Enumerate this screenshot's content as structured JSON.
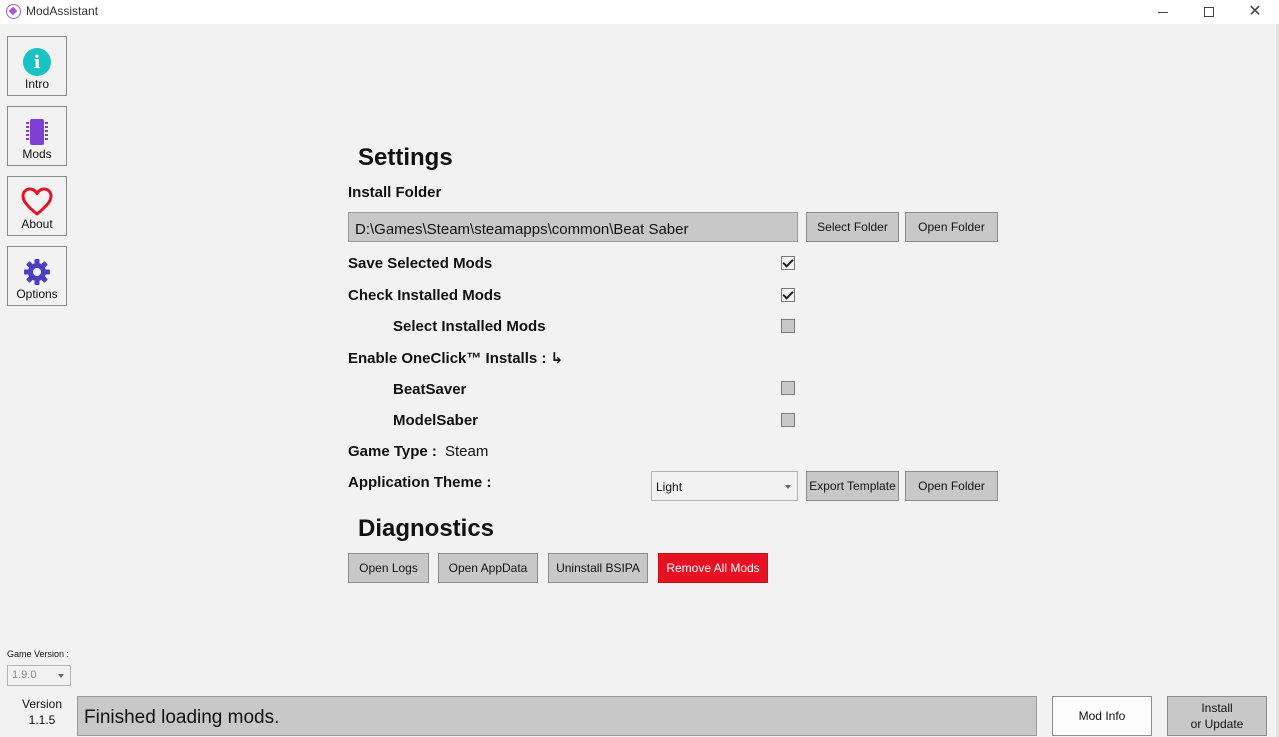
{
  "window": {
    "title": "ModAssistant",
    "logo_icon": "modassistant-logo-icon"
  },
  "sidebar": {
    "items": [
      {
        "label": "Intro",
        "icon": "info-icon",
        "color": "#19c3c3"
      },
      {
        "label": "Mods",
        "icon": "chip-icon",
        "color": "#7e3fd6"
      },
      {
        "label": "About",
        "icon": "heart-icon",
        "color": "#e81123"
      },
      {
        "label": "Options",
        "icon": "gear-icon",
        "color": "#4b3fc4"
      }
    ]
  },
  "settings": {
    "heading": "Settings",
    "install_folder_label": "Install Folder",
    "install_folder_value": "D:\\Games\\Steam\\steamapps\\common\\Beat Saber",
    "select_folder_button": "Select Folder",
    "open_folder_button": "Open Folder",
    "save_selected_mods": {
      "label": "Save Selected Mods",
      "checked": true
    },
    "check_installed_mods": {
      "label": "Check Installed Mods",
      "checked": true
    },
    "select_installed_mods": {
      "label": "Select Installed Mods",
      "checked": false
    },
    "oneclick_label": "Enable OneClick™ Installs : ↳",
    "beatsaver": {
      "label": "BeatSaver",
      "checked": false
    },
    "modelsaber": {
      "label": "ModelSaber",
      "checked": false
    },
    "game_type_label": "Game Type :",
    "game_type_value": "Steam",
    "app_theme_label": "Application Theme :",
    "theme_selected": "Light",
    "export_template_button": "Export Template",
    "theme_open_folder_button": "Open Folder"
  },
  "diagnostics": {
    "heading": "Diagnostics",
    "open_logs": "Open Logs",
    "open_appdata": "Open AppData",
    "uninstall_bsipa": "Uninstall BSIPA",
    "remove_all_mods": "Remove All Mods",
    "danger_color": "#e81123"
  },
  "footer": {
    "game_version_label": "Game Version :",
    "game_version_value": "1.9.0",
    "version_label": "Version",
    "version_value": "1.1.5",
    "status_text": "Finished loading mods.",
    "mod_info_button": "Mod Info",
    "install_button_line1": "Install",
    "install_button_line2": "or Update"
  }
}
